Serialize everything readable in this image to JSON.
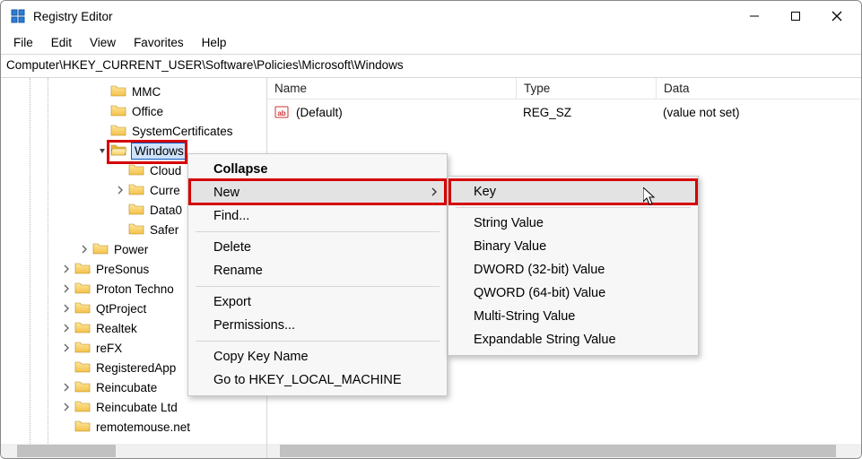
{
  "title": "Registry Editor",
  "menu": {
    "file": "File",
    "edit": "Edit",
    "view": "View",
    "favorites": "Favorites",
    "help": "Help"
  },
  "path": "Computer\\HKEY_CURRENT_USER\\Software\\Policies\\Microsoft\\Windows",
  "columns": {
    "name": "Name",
    "type": "Type",
    "data": "Data"
  },
  "values": [
    {
      "name": "(Default)",
      "type": "REG_SZ",
      "data": "(value not set)"
    }
  ],
  "tree": {
    "items": [
      {
        "indent": 6,
        "expander": "none",
        "label": "MMC"
      },
      {
        "indent": 6,
        "expander": "none",
        "label": "Office"
      },
      {
        "indent": 6,
        "expander": "none",
        "label": "SystemCertificates"
      },
      {
        "indent": 6,
        "expander": "open",
        "label": "Windows",
        "selected": true,
        "open": true
      },
      {
        "indent": 7,
        "expander": "none",
        "label": "Cloud"
      },
      {
        "indent": 7,
        "expander": "closed",
        "label": "Curre"
      },
      {
        "indent": 7,
        "expander": "none",
        "label": "Data0"
      },
      {
        "indent": 7,
        "expander": "none",
        "label": "Safer"
      },
      {
        "indent": 5,
        "expander": "closed",
        "label": "Power"
      },
      {
        "indent": 4,
        "expander": "closed",
        "label": "PreSonus"
      },
      {
        "indent": 4,
        "expander": "closed",
        "label": "Proton Techno"
      },
      {
        "indent": 4,
        "expander": "closed",
        "label": "QtProject"
      },
      {
        "indent": 4,
        "expander": "closed",
        "label": "Realtek"
      },
      {
        "indent": 4,
        "expander": "closed",
        "label": "reFX"
      },
      {
        "indent": 4,
        "expander": "none",
        "label": "RegisteredApp"
      },
      {
        "indent": 4,
        "expander": "closed",
        "label": "Reincubate"
      },
      {
        "indent": 4,
        "expander": "closed",
        "label": "Reincubate Ltd"
      },
      {
        "indent": 4,
        "expander": "none",
        "label": "remotemouse.net"
      }
    ]
  },
  "context_menu": {
    "items": [
      {
        "label": "Collapse",
        "bold": true
      },
      {
        "label": "New",
        "hover": true,
        "arrow": true
      },
      {
        "label": "Find..."
      },
      {
        "sep": true
      },
      {
        "label": "Delete"
      },
      {
        "label": "Rename"
      },
      {
        "sep": true
      },
      {
        "label": "Export"
      },
      {
        "label": "Permissions..."
      },
      {
        "sep": true
      },
      {
        "label": "Copy Key Name"
      },
      {
        "label": "Go to HKEY_LOCAL_MACHINE"
      }
    ]
  },
  "sub_menu": {
    "items": [
      {
        "label": "Key",
        "hover": true
      },
      {
        "sep": true
      },
      {
        "label": "String Value"
      },
      {
        "label": "Binary Value"
      },
      {
        "label": "DWORD (32-bit) Value"
      },
      {
        "label": "QWORD (64-bit) Value"
      },
      {
        "label": "Multi-String Value"
      },
      {
        "label": "Expandable String Value"
      }
    ]
  }
}
